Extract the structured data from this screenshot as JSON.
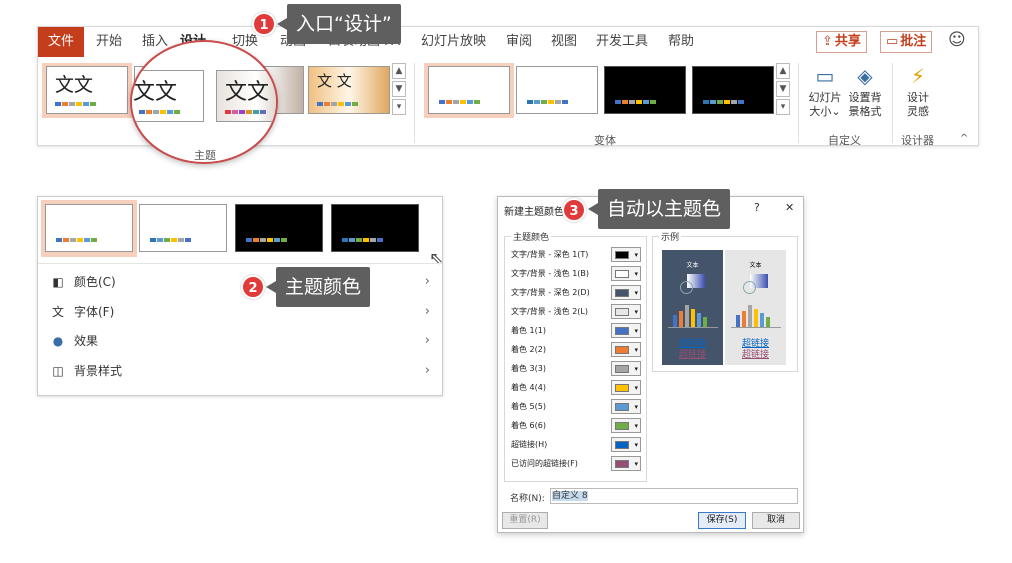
{
  "ribbon": {
    "tabs": [
      "文件",
      "开始",
      "插入",
      "设计",
      "切换",
      "动画",
      "口袋动画 PA",
      "幻灯片放映",
      "审阅",
      "视图",
      "开发工具",
      "帮助"
    ],
    "active_tab": "设计",
    "share_label": "共享",
    "comment_label": "批注",
    "theme_sample_text": "文文",
    "theme_sample_text_alt": "文文",
    "theme_sample_text_4": "文 文",
    "group_theme_label": "主题",
    "group_variant_label": "变体",
    "group_custom_label": "自定义",
    "group_designer_label": "设计器",
    "btn_slide_size": [
      "幻灯片",
      "大小",
      "⌄"
    ],
    "btn_bg_format": [
      "设置背",
      "景格式"
    ],
    "btn_design_ideas": [
      "设计",
      "灵感"
    ]
  },
  "callouts": [
    {
      "num": "1",
      "text": "入口“设计”"
    },
    {
      "num": "2",
      "text": "主题颜色"
    },
    {
      "num": "3",
      "text": "自动以主题色"
    }
  ],
  "variants_menu": {
    "items": [
      {
        "label": "颜色(C)",
        "icon": "color-palette-icon"
      },
      {
        "label": "字体(F)",
        "icon": "font-icon"
      },
      {
        "label": "效果",
        "icon": "effects-icon"
      },
      {
        "label": "背景样式",
        "icon": "background-style-icon"
      }
    ]
  },
  "dialog": {
    "title": "新建主题颜色",
    "help": "?",
    "close": "✕",
    "group_theme_colors": "主题颜色",
    "group_sample": "示例",
    "rows": [
      {
        "label": "文字/背景 - 深色 1(T)",
        "color": "#000000"
      },
      {
        "label": "文字/背景 - 浅色 1(B)",
        "color": "#ffffff"
      },
      {
        "label": "文字/背景 - 深色 2(D)",
        "color": "#44546a"
      },
      {
        "label": "文字/背景 - 浅色 2(L)",
        "color": "#e7e6e6"
      },
      {
        "label": "着色 1(1)",
        "color": "#4472c4"
      },
      {
        "label": "着色 2(2)",
        "color": "#ed7d31"
      },
      {
        "label": "着色 3(3)",
        "color": "#a5a5a5"
      },
      {
        "label": "着色 4(4)",
        "color": "#ffc000"
      },
      {
        "label": "着色 5(5)",
        "color": "#5b9bd5"
      },
      {
        "label": "着色 6(6)",
        "color": "#70ad47"
      },
      {
        "label": "超链接(H)",
        "color": "#0563c1"
      },
      {
        "label": "已访问的超链接(F)",
        "color": "#954f72"
      }
    ],
    "preview_text": "文本",
    "preview_link": "超链接",
    "preview_visited": "超链接",
    "name_label": "名称(N):",
    "name_value": "自定义 8",
    "reset_label": "重置(R)",
    "save_label": "保存(S)",
    "cancel_label": "取消"
  },
  "colors": {
    "accent": "#c43e1c",
    "callout_bg": "#5f5f5f",
    "badge": "#e03a3a"
  }
}
